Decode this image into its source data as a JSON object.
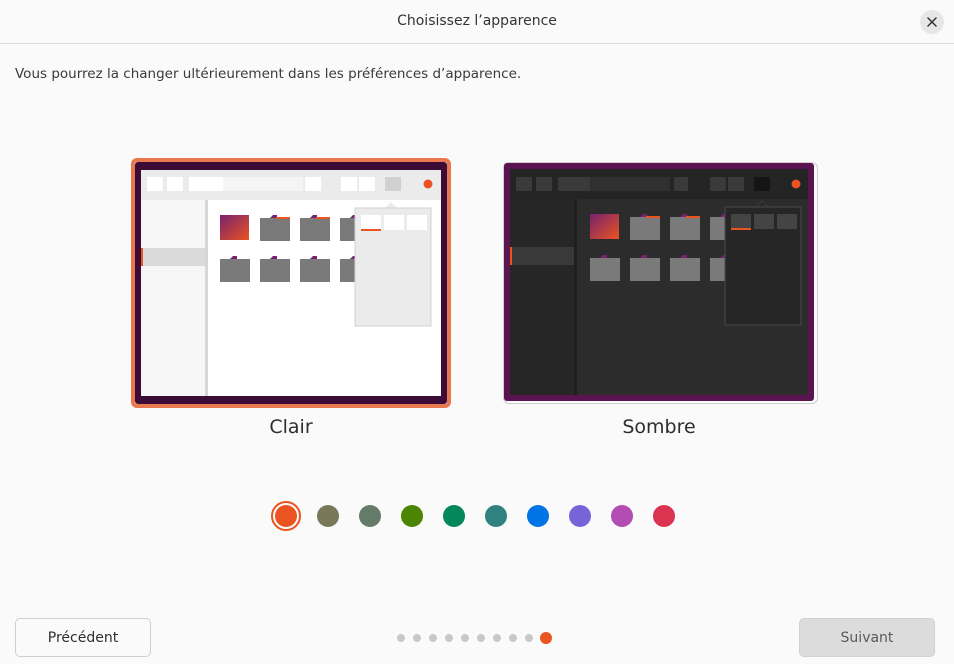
{
  "window": {
    "title": "Choisissez l’apparence",
    "close_icon": "close-icon"
  },
  "subtitle": "Vous pourrez la changer ultérieurement dans les préférences d’apparence.",
  "themes": [
    {
      "label": "Clair",
      "selected": true
    },
    {
      "label": "Sombre",
      "selected": false
    }
  ],
  "accents": [
    {
      "name": "orange",
      "color": "#e95420",
      "selected": true
    },
    {
      "name": "bark",
      "color": "#787859"
    },
    {
      "name": "sage",
      "color": "#657b69"
    },
    {
      "name": "olive",
      "color": "#4b8501"
    },
    {
      "name": "viridian",
      "color": "#03875b"
    },
    {
      "name": "prussiangreen",
      "color": "#308280"
    },
    {
      "name": "blue",
      "color": "#0073e5"
    },
    {
      "name": "purple",
      "color": "#7764d8"
    },
    {
      "name": "magenta",
      "color": "#b34cb3"
    },
    {
      "name": "red",
      "color": "#da3450"
    }
  ],
  "buttons": {
    "previous": "Précédent",
    "next": "Suivant"
  },
  "pager": {
    "total": 10,
    "current": 10
  }
}
